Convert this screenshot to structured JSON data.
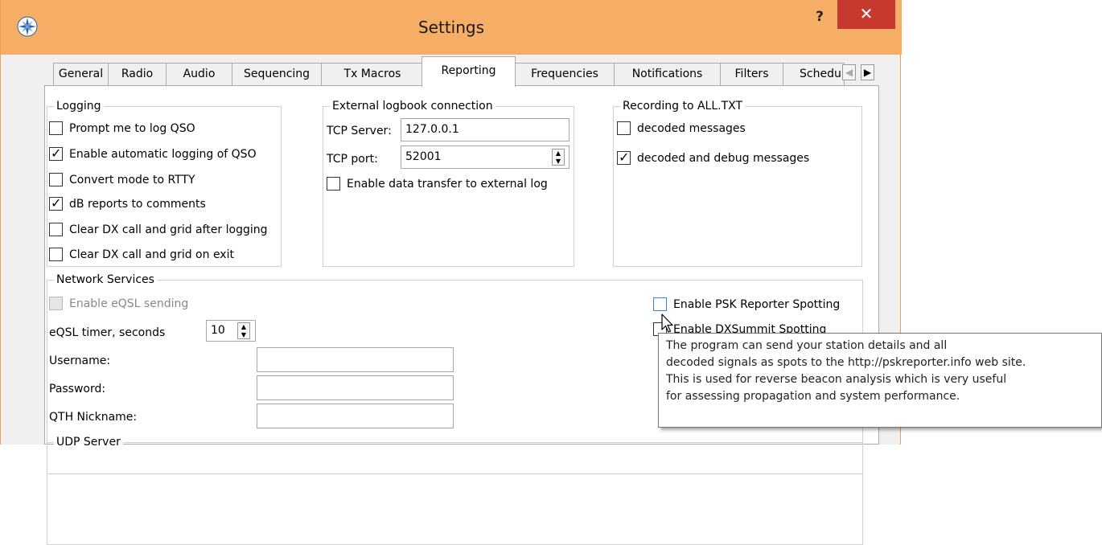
{
  "window": {
    "title": "Settings",
    "help_label": "?",
    "close_label": "✕"
  },
  "tabs": [
    "General",
    "Radio",
    "Audio",
    "Sequencing",
    "Tx Macros",
    "Reporting",
    "Frequencies",
    "Notifications",
    "Filters",
    "Schedu"
  ],
  "active_tab": "Reporting",
  "tab_scroll": {
    "left": "◀",
    "right": "▶"
  },
  "logging": {
    "title": "Logging",
    "items": [
      {
        "label": "Prompt me to log QSO",
        "checked": false
      },
      {
        "label": "Enable automatic logging of QSO",
        "checked": true
      },
      {
        "label": "Convert mode to RTTY",
        "checked": false
      },
      {
        "label": "dB reports to comments",
        "checked": true
      },
      {
        "label": "Clear DX call and grid after logging",
        "checked": false
      },
      {
        "label": "Clear DX call and grid on exit",
        "checked": false
      }
    ]
  },
  "external_logbook": {
    "title": "External logbook connection",
    "tcp_server_label": "TCP Server:",
    "tcp_server_value": "127.0.0.1",
    "tcp_port_label": "TCP port:",
    "tcp_port_value": "52001",
    "transfer_label": "Enable data transfer to external log",
    "transfer_checked": false
  },
  "recording": {
    "title": "Recording to ALL.TXT",
    "items": [
      {
        "label": "decoded messages",
        "checked": false
      },
      {
        "label": "decoded and debug messages",
        "checked": true
      }
    ]
  },
  "network": {
    "title": "Network Services",
    "eqsl_label": "Enable eQSL sending",
    "eqsl_timer_label": "eQSL timer, seconds",
    "eqsl_timer_value": "10",
    "username_label": "Username:",
    "password_label": "Password:",
    "qth_label": "QTH Nickname:",
    "psk_label": "Enable PSK Reporter Spotting",
    "dxsummit_label": "Enable DXSummit Spotting"
  },
  "udp": {
    "title": "UDP Server"
  },
  "tooltip": {
    "lines": [
      "The program can send your station details and all",
      "decoded signals as spots to the http://pskreporter.info web site.",
      "This is used for reverse beacon analysis which is very useful",
      "for assessing propagation and system performance."
    ]
  },
  "colors": {
    "titlebar": "#f6ae67",
    "close": "#c7392e"
  }
}
